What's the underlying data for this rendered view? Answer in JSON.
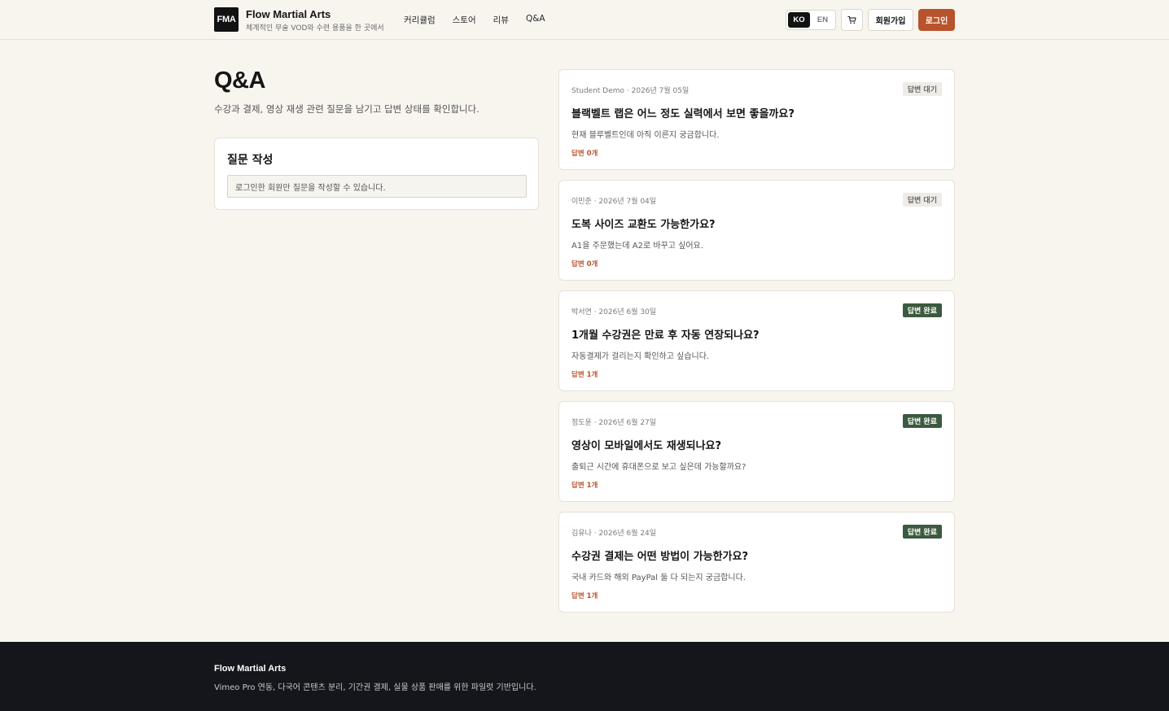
{
  "header": {
    "logo": "FMA",
    "brand_name": "Flow Martial Arts",
    "tagline": "체계적인 무술 VOD와 수련 용품을 한 곳에서",
    "nav": [
      "커리큘럼",
      "스토어",
      "리뷰",
      "Q&A"
    ],
    "lang": {
      "ko": "KO",
      "en": "EN",
      "active": "KO"
    },
    "cart_icon": "cart-icon",
    "signup_label": "회원가입",
    "login_label": "로그인"
  },
  "main": {
    "title": "Q&A",
    "description": "수강과 결제, 영상 재생 관련 질문을 남기고 답변 상태를 확인합니다.",
    "ask": {
      "title": "질문 작성",
      "notice": "로그인한 회원만 질문을 작성할 수 있습니다."
    }
  },
  "questions": [
    {
      "meta": "Student Demo · 2026년 7월 05일",
      "status": "답변 대기",
      "state": "waiting",
      "title": "블랙벨트 랩은 어느 정도 실력에서 보면 좋을까요?",
      "body": "현재 블루벨트인데 아직 이른지 궁금합니다.",
      "answers": "답변 0개"
    },
    {
      "meta": "이민준 · 2026년 7월 04일",
      "status": "답변 대기",
      "state": "waiting",
      "title": "도복 사이즈 교환도 가능한가요?",
      "body": "A1을 주문했는데 A2로 바꾸고 싶어요.",
      "answers": "답변 0개"
    },
    {
      "meta": "박서연 · 2026년 6월 30일",
      "status": "답변 완료",
      "state": "done",
      "title": "1개월 수강권은 만료 후 자동 연장되나요?",
      "body": "자동결제가 걸리는지 확인하고 싶습니다.",
      "answers": "답변 1개"
    },
    {
      "meta": "정도윤 · 2026년 6월 27일",
      "status": "답변 완료",
      "state": "done",
      "title": "영상이 모바일에서도 재생되나요?",
      "body": "출퇴근 시간에 휴대폰으로 보고 싶은데 가능할까요?",
      "answers": "답변 1개"
    },
    {
      "meta": "김유나 · 2026년 6월 24일",
      "status": "답변 완료",
      "state": "done",
      "title": "수강권 결제는 어떤 방법이 가능한가요?",
      "body": "국내 카드와 해외 PayPal 둘 다 되는지 궁금합니다.",
      "answers": "답변 1개"
    }
  ],
  "footer": {
    "brand": "Flow Martial Arts",
    "description": "Vimeo Pro 연동, 다국어 콘텐츠 분리, 기간권 결제, 실물 상품 판매를 위한 파일럿 기반입니다."
  },
  "colors": {
    "background": "#f8f5ef",
    "accent": "#b9532c",
    "done_badge": "#3c5a3f",
    "footer": "#15161b"
  }
}
